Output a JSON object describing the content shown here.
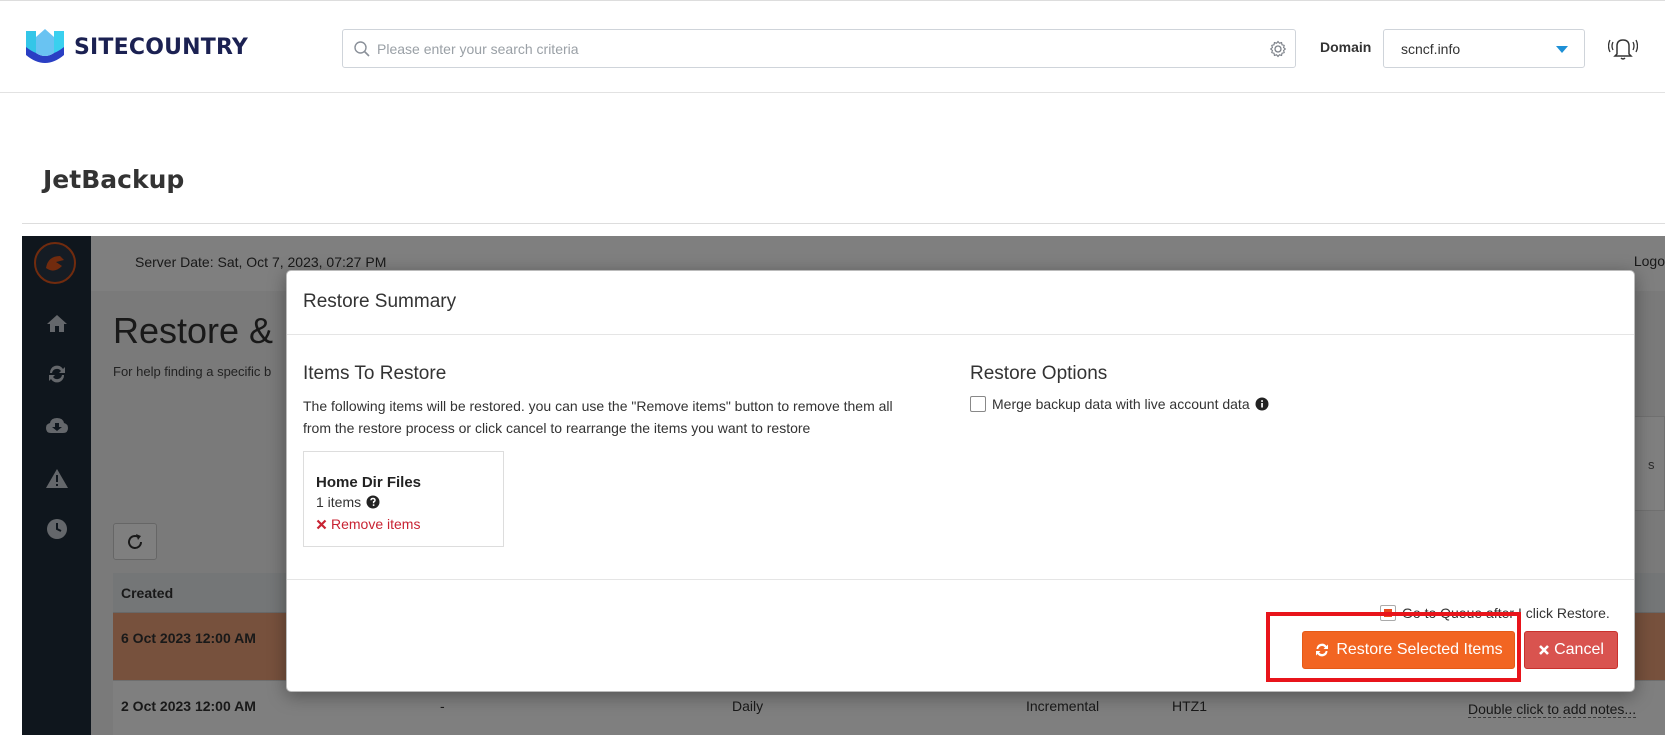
{
  "header": {
    "brand": "SITECOUNTRY",
    "search_placeholder": "Please enter your search criteria",
    "domain_label": "Domain",
    "domain_value": "scncf.info"
  },
  "page_title": "JetBackup",
  "app": {
    "server_date": "Server Date: Sat, Oct 7, 2023, 07:27 PM",
    "logout": "Logo",
    "main_title": "Restore & D",
    "help_text": "For help finding a specific b",
    "filter_tail": "s",
    "table": {
      "header_created": "Created",
      "rows": [
        {
          "created": "6 Oct 2023 12:00 AM"
        },
        {
          "created": "2 Oct 2023 12:00 AM",
          "dash": "-",
          "schedule": "Daily",
          "type": "Incremental",
          "location": "HTZ1",
          "notes": "Double click to add notes..."
        }
      ]
    }
  },
  "modal": {
    "title": "Restore Summary",
    "items_title": "Items To Restore",
    "items_desc": "The following items will be restored. you can use the \"Remove items\" button to remove them all from the restore process or click cancel to rearrange the items you want to restore",
    "card": {
      "title": "Home Dir Files",
      "count": "1 items",
      "remove": "Remove items"
    },
    "options_title": "Restore Options",
    "merge_label": "Merge backup data with live account data",
    "queue_label": "Go to Queue after I click Restore.",
    "restore_button": "Restore Selected Items",
    "cancel_button": "Cancel"
  },
  "colors": {
    "accent": "#f26522",
    "danger": "#d9534f",
    "sidebar": "#1f2d3a",
    "highlight": "#e8141b"
  }
}
